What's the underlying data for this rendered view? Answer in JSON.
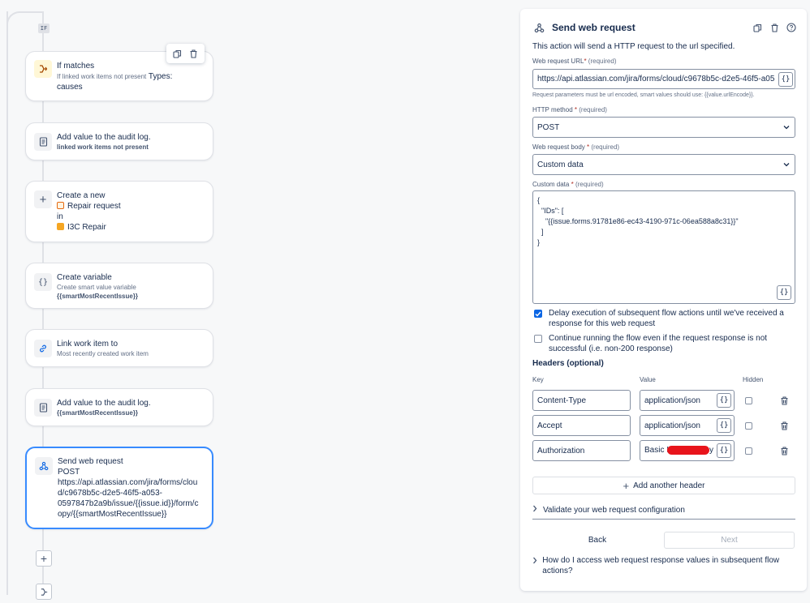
{
  "flow": {
    "if_badge": "IF",
    "cards": [
      {
        "title": "If matches",
        "sub": "If linked work items not present",
        "extra": "Types:",
        "line2": "causes"
      },
      {
        "title": "Add value to the audit log.",
        "subb": "linked work items not present"
      },
      {
        "title": "Create a new",
        "line1": "Repair request",
        "line2": "in",
        "line3": "I3C Repair"
      },
      {
        "title": "Create variable",
        "sub": "Create smart value variable",
        "subb": "{{smartMostRecentIssue}}"
      },
      {
        "title": "Link work item to",
        "sub": "Most recently created work item"
      },
      {
        "title": "Add value to the audit log.",
        "subb": "{{smartMostRecentIssue}}"
      },
      {
        "title": "Send web request",
        "method": "POST",
        "url_lines": [
          "https://api.atlassian.com/jira/forms/clou",
          "d/c9678b5c-d2e5-46f5-a053-",
          "0597847b2a9b/issue/{{issue.id}}/form/c",
          "opy/{{smartMostRecentIssue}}"
        ]
      }
    ]
  },
  "panel": {
    "title": "Send web request",
    "description": "This action will send a HTTP request to the url specified.",
    "url_label": "Web request URL",
    "url_value": "https://api.atlassian.com/jira/forms/cloud/c9678b5c-d2e5-46f5-a05",
    "url_hint": "Request parameters must be url encoded, smart values should use: {{value.urlEncode}}.",
    "method_label": "HTTP method",
    "method_value": "POST",
    "body_label": "Web request body",
    "body_value": "Custom data",
    "custom_label": "Custom data",
    "required_text": "(required)",
    "asterisk": "*",
    "custom_data_lines": [
      "{",
      "  \"IDs\": [",
      "    \"{{issue.forms.91781e86-ec43-4190-971c-06ea588a8c31}}\"",
      "  ]",
      "}"
    ],
    "brace_label": "{}",
    "delay_checkbox": "Delay execution of subsequent flow actions until we've received a response for this web request",
    "continue_checkbox": "Continue running the flow even if the request response is not successful (i.e. non-200 response)",
    "headers_title": "Headers (optional)",
    "col_key": "Key",
    "col_value": "Value",
    "col_hidden": "Hidden",
    "headers": [
      {
        "key": "Content-Type",
        "value": "application/json"
      },
      {
        "key": "Accept",
        "value": "application/json"
      },
      {
        "key": "Authorization",
        "value": "Basic I",
        "value_tail": "y"
      }
    ],
    "add_header": "Add another header",
    "validate": "Validate your web request configuration",
    "back": "Back",
    "next": "Next",
    "faq": "How do I access web request response values in subsequent flow actions?"
  }
}
